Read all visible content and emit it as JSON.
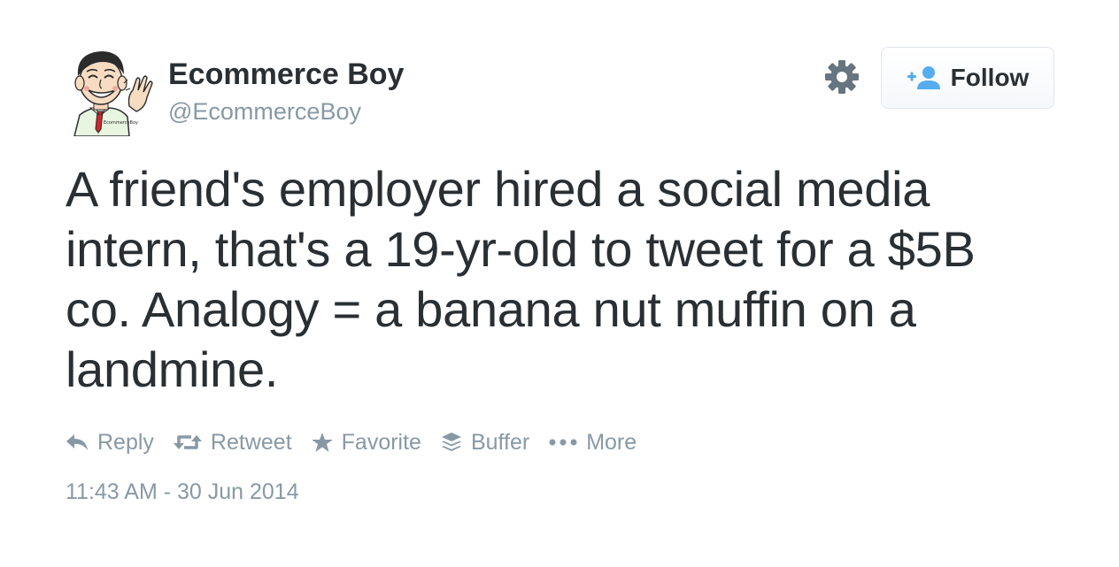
{
  "profile": {
    "name": "Ecommerce Boy",
    "handle": "@EcommerceBoy",
    "avatar_text": "EcommerceBoy"
  },
  "follow_button": {
    "label": "Follow",
    "icon": "follow-person-plus-icon"
  },
  "settings_icon": "gear-icon",
  "tweet": {
    "text": "A friend's employer hired a social media intern, that's a 19-yr-old to tweet for a $5B co. Analogy = a banana nut muffin on a landmine."
  },
  "actions": [
    {
      "label": "Reply",
      "icon": "reply-icon"
    },
    {
      "label": "Retweet",
      "icon": "retweet-icon"
    },
    {
      "label": "Favorite",
      "icon": "star-icon"
    },
    {
      "label": "Buffer",
      "icon": "buffer-icon"
    },
    {
      "label": "More",
      "icon": "more-dots-icon"
    }
  ],
  "timestamp": "11:43 AM - 30 Jun 2014",
  "colors": {
    "text": "#292f33",
    "muted": "#8899a6",
    "accent": "#55acee",
    "border": "#e1e8ed"
  }
}
